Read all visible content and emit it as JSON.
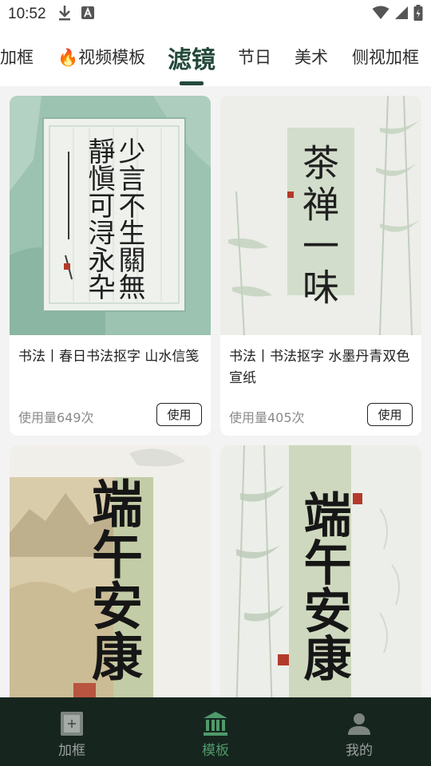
{
  "status_bar": {
    "time": "10:52",
    "icons_left": [
      "download-icon",
      "text-a-icon"
    ],
    "icons_right": [
      "wifi-icon",
      "signal-icon",
      "battery-charging-icon"
    ]
  },
  "tabs": [
    {
      "label": "加框",
      "active": false
    },
    {
      "label": "视频模板",
      "active": false,
      "emoji": "🔥"
    },
    {
      "label": "滤镜",
      "active": true
    },
    {
      "label": "节日",
      "active": false
    },
    {
      "label": "美术",
      "active": false
    },
    {
      "label": "侧视加框",
      "active": false
    }
  ],
  "cards": [
    {
      "title": "书法丨春日书法抠字 山水信笺",
      "usage": "使用量649次",
      "button": "使用",
      "art_text": [
        "少言不生關無",
        "靜愼可浔永卆"
      ]
    },
    {
      "title": "书法丨书法抠字 水墨丹青双色宣纸",
      "usage": "使用量405次",
      "button": "使用",
      "art_text": [
        "茶禅一味"
      ]
    },
    {
      "title": "",
      "usage": "",
      "button": "",
      "art_text": [
        "端午安康"
      ]
    },
    {
      "title": "",
      "usage": "",
      "button": "",
      "art_text": [
        "端午安康"
      ]
    }
  ],
  "bottom_nav": [
    {
      "label": "加框",
      "icon": "frame-add-icon",
      "active": false
    },
    {
      "label": "模板",
      "icon": "template-icon",
      "active": true
    },
    {
      "label": "我的",
      "icon": "profile-icon",
      "active": false
    }
  ],
  "colors": {
    "accent": "#23493a",
    "nav_bg": "#17251f",
    "nav_active": "#4f9a6a"
  }
}
